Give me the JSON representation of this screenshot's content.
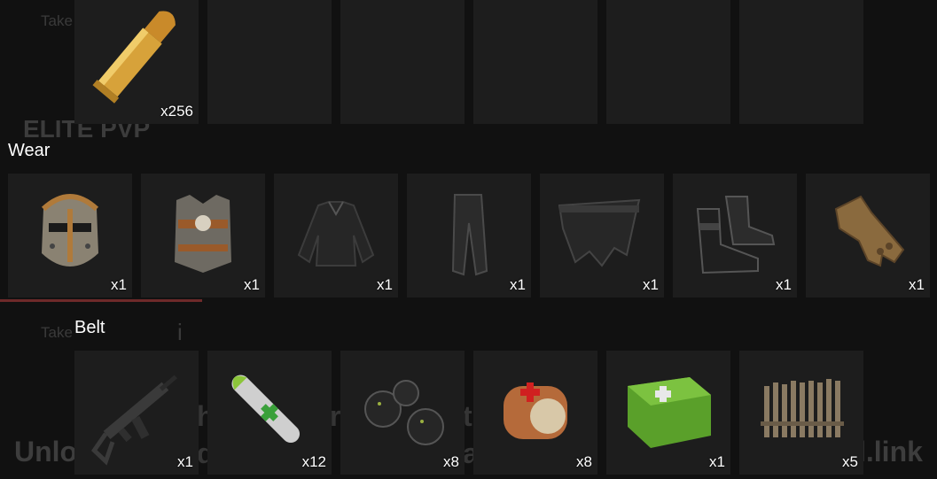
{
  "background": {
    "take_text_1": "Take",
    "take_text_2": "Take",
    "server_name": "ELITE PVP",
    "unlock_text": "Unlo",
    "link_text": "l.link",
    "cursor_char": "i"
  },
  "top_row": {
    "items": [
      {
        "icon": "rifle-ammo-icon",
        "qty": "x256"
      },
      {
        "icon": "",
        "qty": ""
      },
      {
        "icon": "",
        "qty": ""
      },
      {
        "icon": "",
        "qty": ""
      },
      {
        "icon": "",
        "qty": ""
      },
      {
        "icon": "",
        "qty": ""
      }
    ]
  },
  "wear": {
    "label": "Wear",
    "items": [
      {
        "icon": "metal-facemask-icon",
        "qty": "x1"
      },
      {
        "icon": "metal-chestplate-icon",
        "qty": "x1"
      },
      {
        "icon": "black-jacket-icon",
        "qty": "x1"
      },
      {
        "icon": "black-pants-icon",
        "qty": "x1"
      },
      {
        "icon": "roadsign-kilt-icon",
        "qty": "x1"
      },
      {
        "icon": "boots-icon",
        "qty": "x1"
      },
      {
        "icon": "gloves-icon",
        "qty": "x1"
      }
    ]
  },
  "belt": {
    "label": "Belt",
    "items": [
      {
        "icon": "assault-rifle-icon",
        "qty": "x1"
      },
      {
        "icon": "medical-syringe-icon",
        "qty": "x12"
      },
      {
        "icon": "blackberries-icon",
        "qty": "x8"
      },
      {
        "icon": "bandage-icon",
        "qty": "x8"
      },
      {
        "icon": "medkit-icon",
        "qty": "x1"
      },
      {
        "icon": "wooden-barricade-icon",
        "qty": "x5"
      }
    ]
  },
  "colors": {
    "slot_bg": "#1d1d1d",
    "page_bg": "#111111",
    "accent_red": "#6e2a2a"
  }
}
